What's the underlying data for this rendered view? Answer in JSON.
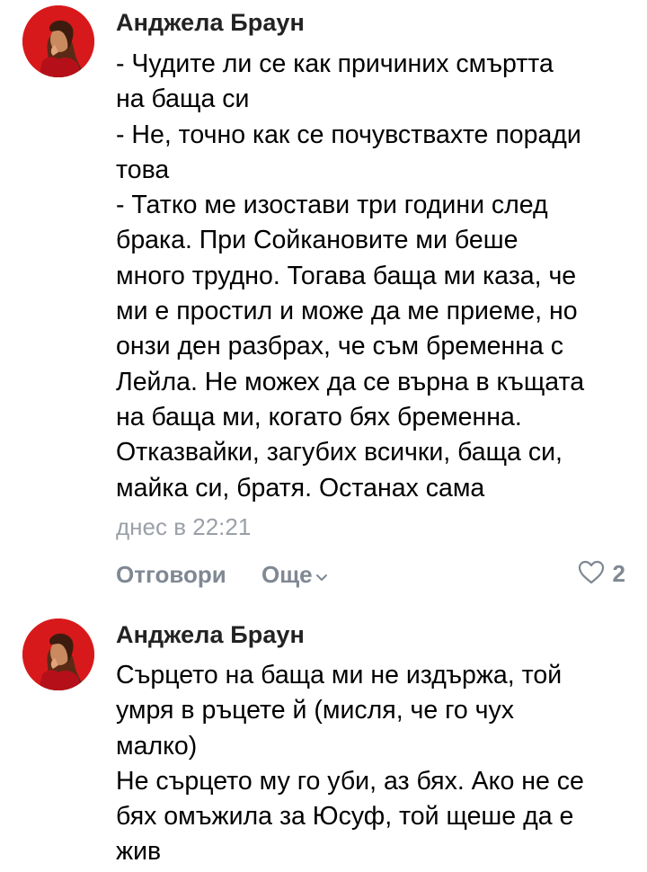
{
  "comments": [
    {
      "author": "Анджела Браун",
      "lines": [
        "- Чудите ли се как причиних смъртта",
        "на баща си",
        "- Не, точно как се почувствахте поради",
        "това",
        "- Татко ме изостави три години след",
        "брака. При Сойкановите ми беше",
        "много трудно. Тогава баща ми каза, че",
        "ми е простил и може да ме приеме, но",
        "онзи ден разбрах, че съм бременна с",
        "Лейла. Не можех да се върна в къщата",
        "на баща ми, когато бях бременна.",
        "Отказвайки, загубих всички, баща си,",
        "майка си, братя. Останах сама"
      ],
      "time": "днес в 22:21",
      "reply_label": "Отговори",
      "more_label": "Още",
      "like_count": "2"
    },
    {
      "author": "Анджела Браун",
      "lines": [
        "Сърцето на баща ми не издържа, той",
        "умря в ръцете й (мисля, че го чух",
        "малко)",
        "Не сърцето му го уби, аз бях. Ако не се",
        "бях омъжила за Юсуф, той щеше да е",
        "жив"
      ]
    }
  ],
  "colors": {
    "author": "#222222",
    "text": "#000000",
    "meta": "#9aa0a8",
    "action": "#7f8893",
    "avatar_bg": "#d8191b"
  },
  "icons": {
    "more": "chevron-down-icon",
    "like": "heart-outline-icon"
  }
}
